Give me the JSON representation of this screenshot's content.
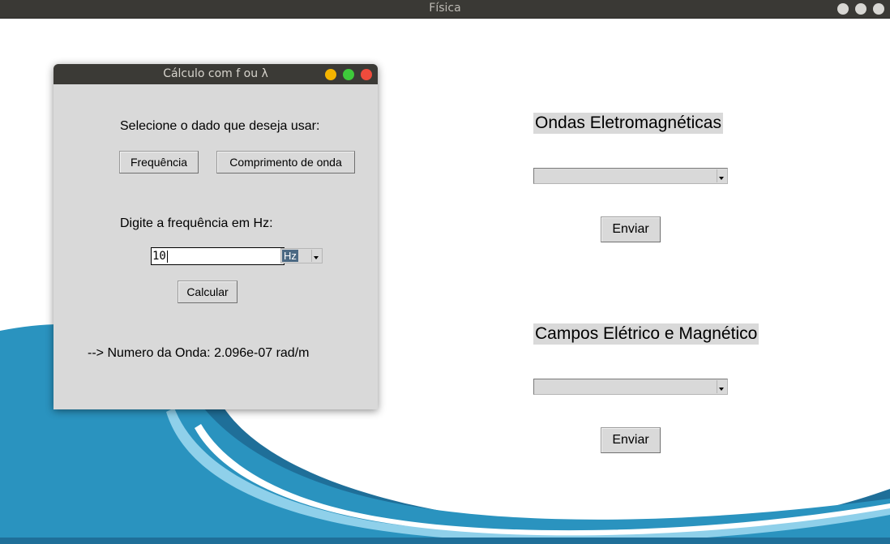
{
  "window": {
    "title": "Física"
  },
  "sections": {
    "ondas": {
      "label": "Ondas Eletromagnéticas",
      "selected": "",
      "submit_label": "Enviar"
    },
    "campos": {
      "label": "Campos Elétrico e Magnético",
      "selected": "",
      "submit_label": "Enviar"
    }
  },
  "dialog": {
    "title": "Cálculo com f ou λ",
    "prompt": "Selecione o dado que deseja usar:",
    "option_buttons": {
      "frequency": "Frequência",
      "wavelength": "Comprimento de onda"
    },
    "input_prompt": "Digite a frequência em Hz:",
    "input_value": "10",
    "unit_selected": "Hz",
    "calculate_label": "Calcular",
    "result": "--> Numero da Onda: 2.096e-07 rad/m"
  },
  "colors": {
    "title_bar": "#3a3935",
    "panel_bg": "#d9d9d9",
    "wave_dark": "#1f6f99",
    "wave_mid": "#2a93bf",
    "wave_light": "#8fd0ea",
    "close_dot": "#ef4b3c",
    "minimize_dot": "#f4b400",
    "maximize_dot": "#3ec93b"
  },
  "icons": [
    "window-control-icon",
    "dropdown-arrow-icon"
  ]
}
